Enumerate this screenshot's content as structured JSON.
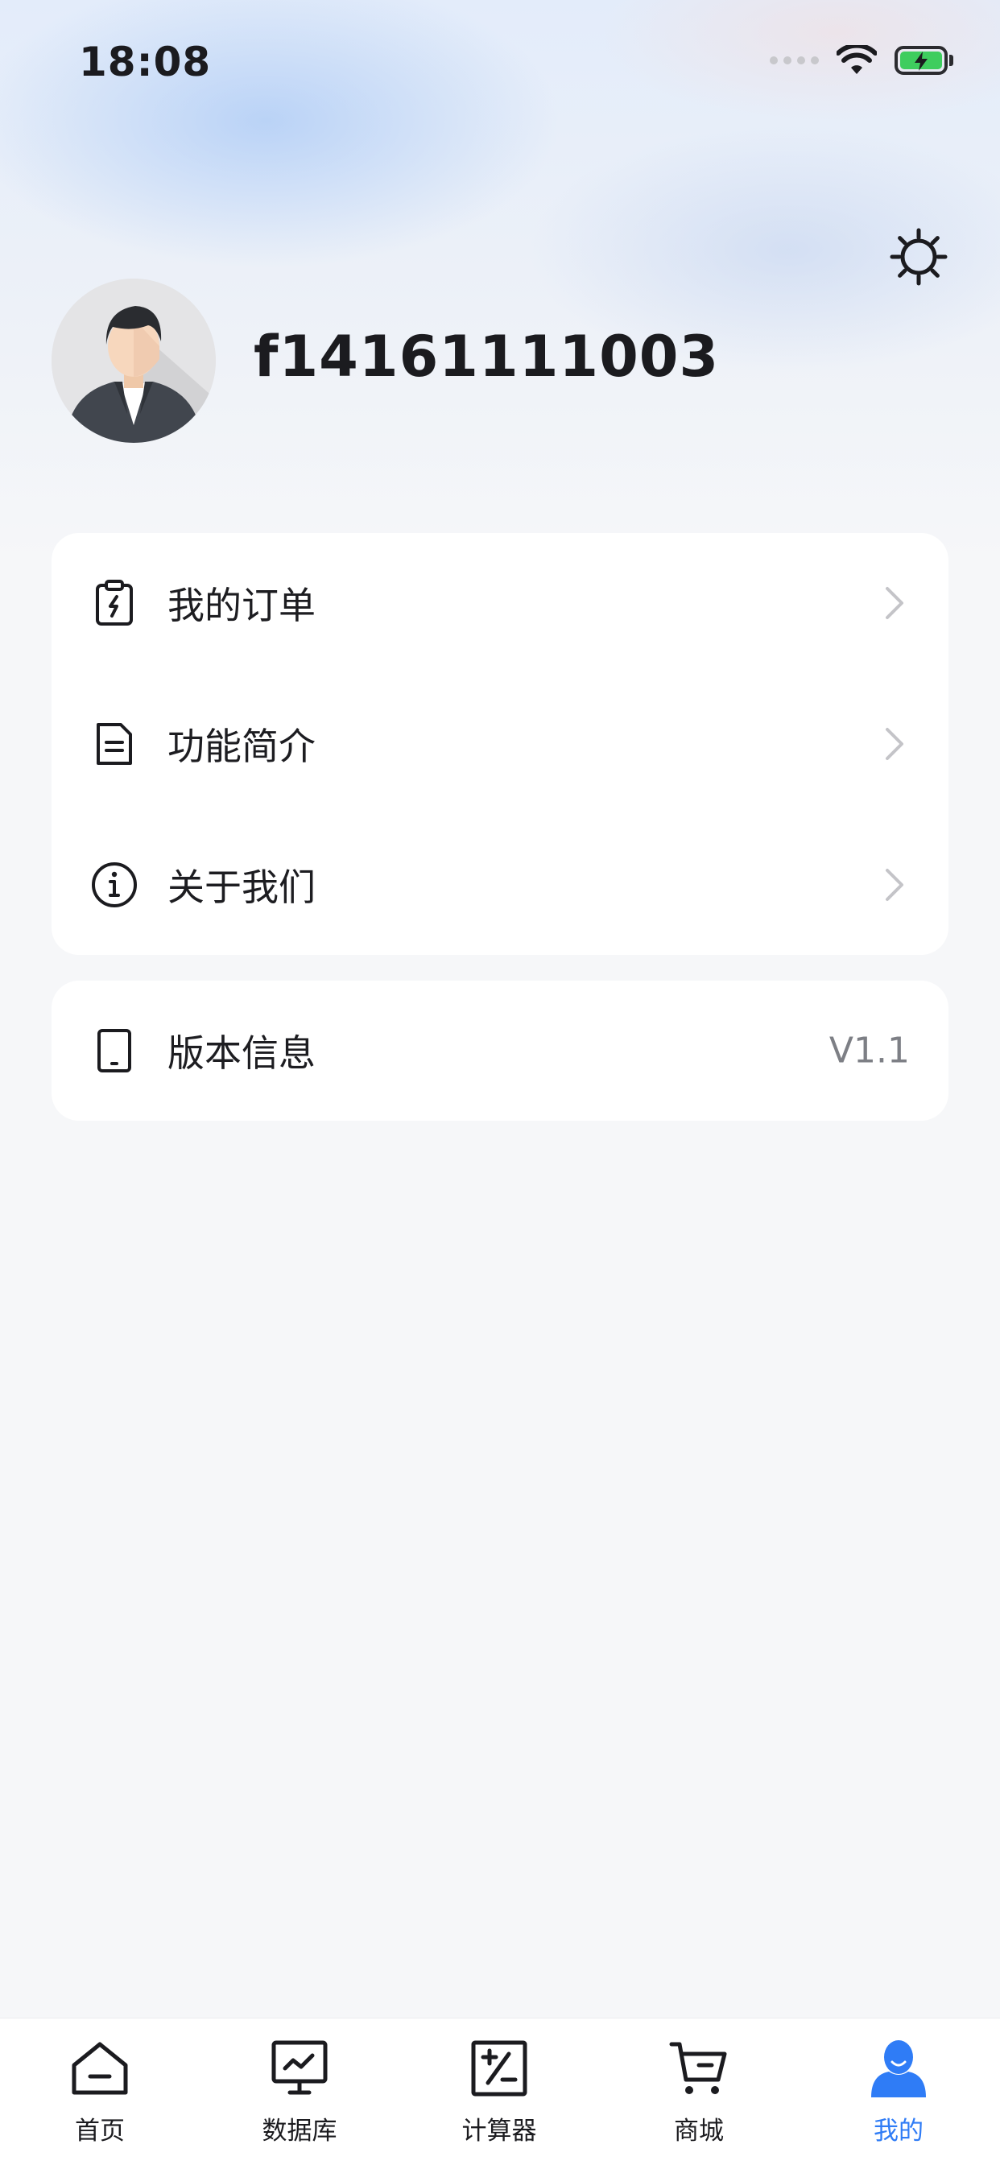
{
  "status_bar": {
    "time": "18:08"
  },
  "profile": {
    "username": "f14161111003"
  },
  "menu": [
    {
      "label": "我的订单",
      "icon": "order-clipboard-icon"
    },
    {
      "label": "功能简介",
      "icon": "document-icon"
    },
    {
      "label": "关于我们",
      "icon": "info-icon"
    }
  ],
  "version": {
    "label": "版本信息",
    "value": "V1.1",
    "icon": "tablet-icon"
  },
  "tabs": [
    {
      "label": "首页",
      "icon": "home-icon"
    },
    {
      "label": "数据库",
      "icon": "database-monitor-icon"
    },
    {
      "label": "计算器",
      "icon": "calculator-icon"
    },
    {
      "label": "商城",
      "icon": "cart-icon"
    },
    {
      "label": "我的",
      "icon": "user-icon",
      "active": true
    }
  ],
  "colors": {
    "accent": "#2f7cf6",
    "battery": "#3ecd5e",
    "chevron": "#c4c4c8"
  }
}
